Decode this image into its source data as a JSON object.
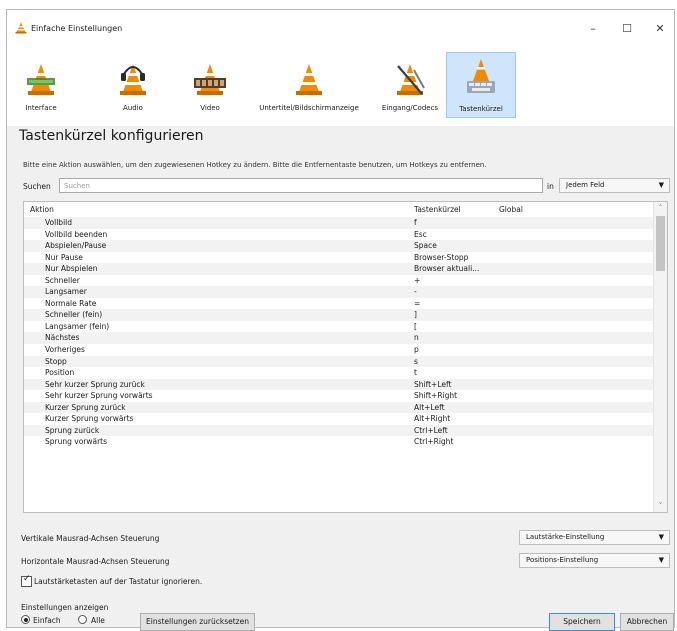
{
  "window": {
    "title": "Einfache Einstellungen",
    "controls": {
      "minimize": "–",
      "maximize": "☐",
      "close": "✕"
    }
  },
  "categories": [
    {
      "label": "Interface",
      "icon": "interface-cone-icon",
      "active": false
    },
    {
      "label": "Audio",
      "icon": "audio-cone-icon",
      "active": false
    },
    {
      "label": "Video",
      "icon": "video-cone-icon",
      "active": false
    },
    {
      "label": "Untertitel/Bildschirmanzeige",
      "icon": "subtitles-cone-icon",
      "active": false
    },
    {
      "label": "Eingang/Codecs",
      "icon": "input-codecs-cone-icon",
      "active": false
    },
    {
      "label": "Tastenkürzel",
      "icon": "hotkeys-cone-icon",
      "active": true
    }
  ],
  "page": {
    "heading": "Tastenkürzel konfigurieren",
    "hint": "Bitte eine Aktion auswählen, um den zugewiesenen Hotkey zu ändern. Bitte die Entfernentaste benutzen, um Hotkeys zu entfernen."
  },
  "search": {
    "label": "Suchen",
    "placeholder": "Suchen",
    "value": "",
    "in_label": "in",
    "scope": "Jedem Feld"
  },
  "table": {
    "headers": {
      "action": "Aktion",
      "hotkey": "Tastenkürzel",
      "global": "Global"
    },
    "rows": [
      {
        "action": "Vollbild",
        "hotkey": "f"
      },
      {
        "action": "Vollbild beenden",
        "hotkey": "Esc"
      },
      {
        "action": "Abspielen/Pause",
        "hotkey": "Space"
      },
      {
        "action": "Nur Pause",
        "hotkey": "Browser-Stopp"
      },
      {
        "action": "Nur Abspielen",
        "hotkey": "Browser aktuali..."
      },
      {
        "action": "Schneller",
        "hotkey": "+"
      },
      {
        "action": "Langsamer",
        "hotkey": "-"
      },
      {
        "action": "Normale Rate",
        "hotkey": "="
      },
      {
        "action": "Schneller (fein)",
        "hotkey": "]"
      },
      {
        "action": "Langsamer (fein)",
        "hotkey": "["
      },
      {
        "action": "Nächstes",
        "hotkey": "n"
      },
      {
        "action": "Vorheriges",
        "hotkey": "p"
      },
      {
        "action": "Stopp",
        "hotkey": "s"
      },
      {
        "action": "Position",
        "hotkey": "t"
      },
      {
        "action": "Sehr kurzer Sprung zurück",
        "hotkey": "Shift+Left"
      },
      {
        "action": "Sehr kurzer Sprung vorwärts",
        "hotkey": "Shift+Right"
      },
      {
        "action": "Kurzer Sprung zurück",
        "hotkey": "Alt+Left"
      },
      {
        "action": "Kurzer Sprung vorwärts",
        "hotkey": "Alt+Right"
      },
      {
        "action": "Sprung zurück",
        "hotkey": "Ctrl+Left"
      },
      {
        "action": "Sprung vorwärts",
        "hotkey": "Ctrl+Right"
      }
    ]
  },
  "options": {
    "vertical_label": "Vertikale Mausrad-Achsen Steuerung",
    "vertical_value": "Lautstärke-Einstellung",
    "horizontal_label": "Horizontale Mausrad-Achsen Steuerung",
    "horizontal_value": "Positions-Einstellung",
    "ignore_volume_keys_label": "Lautstärketasten auf der Tastatur ignorieren.",
    "ignore_volume_keys_checked": true
  },
  "footer": {
    "show_label": "Einstellungen anzeigen",
    "radio_simple": "Einfach",
    "radio_all": "Alle",
    "selected": "Einfach",
    "reset_button": "Einstellungen zurücksetzen",
    "save_button": "Speichern",
    "cancel_button": "Abbrechen"
  },
  "colors": {
    "cone_orange": "#f28a00",
    "active_tab_bg": "#cfe5fb",
    "save_border": "#3c8de0"
  }
}
